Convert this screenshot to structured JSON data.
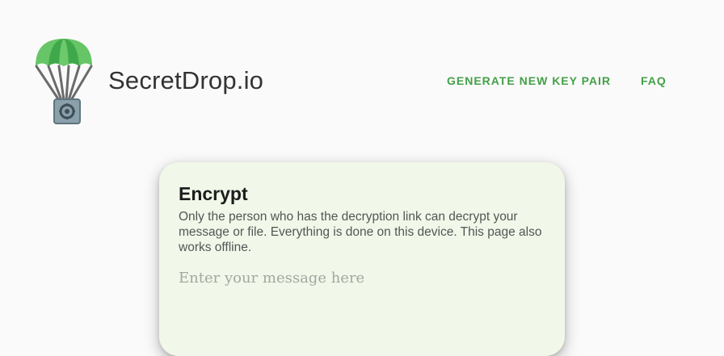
{
  "header": {
    "brand": "SecretDrop.io",
    "logo_icon": "parachute-safe-icon",
    "nav": [
      {
        "label": "GENERATE NEW KEY PAIR"
      },
      {
        "label": "FAQ"
      }
    ]
  },
  "card": {
    "title": "Encrypt",
    "description": "Only the person who has the decryption link can decrypt your message or file. Everything is done on this device. This page also works offline.",
    "input": {
      "placeholder": "Enter your message here",
      "value": ""
    }
  },
  "colors": {
    "accent": "#43a047",
    "card_bg": "#f1f8e9",
    "page_bg": "#fafafa"
  }
}
